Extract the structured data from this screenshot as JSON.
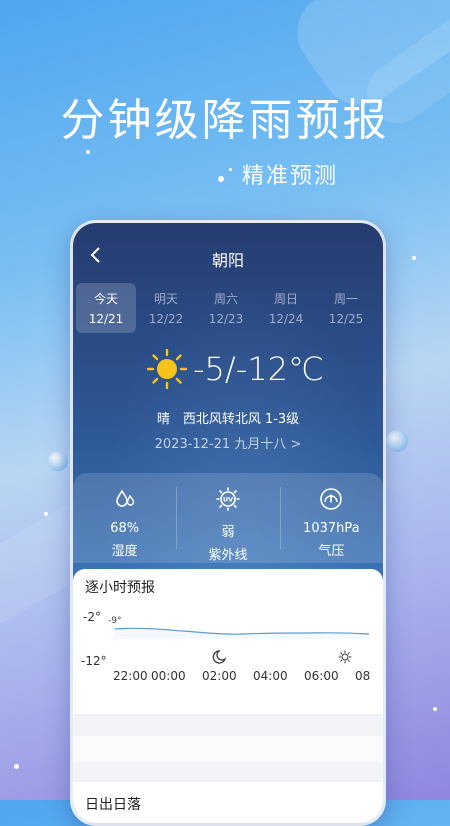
{
  "promo": {
    "headline": "分钟级降雨预报",
    "subhead": "精准预测"
  },
  "header": {
    "back_icon": "chevron-left-icon",
    "city": "朝阳"
  },
  "days": [
    {
      "name": "今天",
      "date": "12/21",
      "active": true
    },
    {
      "name": "明天",
      "date": "12/22",
      "active": false
    },
    {
      "name": "周六",
      "date": "12/23",
      "active": false
    },
    {
      "name": "周日",
      "date": "12/24",
      "active": false
    },
    {
      "name": "周一",
      "date": "12/25",
      "active": false
    }
  ],
  "current": {
    "weather_icon": "sun-icon",
    "temperature": "-5/-12℃",
    "condition": "晴　西北风转北风 1-3级",
    "date": "2023-12-21 九月十八 >"
  },
  "stats": [
    {
      "icon": "humidity-icon",
      "value": "68%",
      "label": "湿度"
    },
    {
      "icon": "uv-icon",
      "value": "弱",
      "label": "紫外线"
    },
    {
      "icon": "pressure-gauge-icon",
      "value": "1037hPa",
      "label": "气压"
    }
  ],
  "hourly": {
    "title": "逐小时预报",
    "high_label": "-2°",
    "low_label": "-12°",
    "point_label": "-9°",
    "times": [
      "22:00",
      "00:00",
      "02:00",
      "04:00",
      "06:00",
      "08"
    ],
    "icons": [
      "moon-icon",
      "sun-icon"
    ],
    "line_color": "#5b9bd5"
  },
  "sunrise": {
    "title": "日出日落"
  },
  "colors": {
    "sun": "#f6c21b",
    "bubble": "#8fc0ef"
  }
}
